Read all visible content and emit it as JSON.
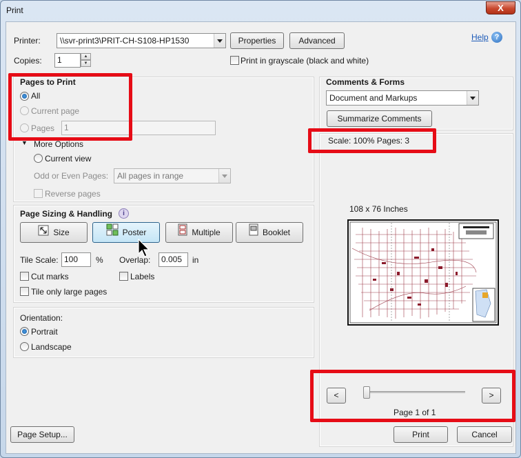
{
  "window": {
    "title": "Print",
    "close_glyph": "X"
  },
  "printer": {
    "label": "Printer:",
    "selected": "\\\\svr-print3\\PRIT-CH-S108-HP1530",
    "properties_button": "Properties",
    "advanced_button": "Advanced",
    "help_link": "Help",
    "help_icon": "?"
  },
  "copies": {
    "label": "Copies:",
    "value": "1",
    "grayscale_label": "Print in grayscale (black and white)"
  },
  "pages_to_print": {
    "title": "Pages to Print",
    "all_label": "All",
    "current_page_label": "Current page",
    "pages_label": "Pages",
    "pages_value": "1",
    "more_options_label": "More Options",
    "current_view_label": "Current view",
    "odd_even_label": "Odd or Even Pages:",
    "odd_even_value": "All pages in range",
    "reverse_label": "Reverse pages"
  },
  "page_sizing": {
    "title": "Page Sizing & Handling",
    "info_glyph": "i",
    "size_button": "Size",
    "poster_button": "Poster",
    "multiple_button": "Multiple",
    "booklet_button": "Booklet",
    "tile_scale_label": "Tile Scale:",
    "tile_scale_value": "100",
    "tile_scale_unit": "%",
    "overlap_label": "Overlap:",
    "overlap_value": "0.005",
    "overlap_unit": "in",
    "cut_marks_label": "Cut marks",
    "labels_label": "Labels",
    "tile_large_label": "Tile only large pages"
  },
  "orientation": {
    "title": "Orientation:",
    "portrait_label": "Portrait",
    "landscape_label": "Landscape"
  },
  "comments_forms": {
    "title": "Comments & Forms",
    "selected": "Document and Markups",
    "summarize_button": "Summarize Comments"
  },
  "preview": {
    "scale_text": "Scale: 100% Pages: 3",
    "size_text": "108 x 76 Inches",
    "prev_button": "<",
    "next_button": ">",
    "page_text": "Page 1 of 1",
    "page_slider_fraction": 0
  },
  "footer": {
    "page_setup_button": "Page Setup...",
    "print_button": "Print",
    "cancel_button": "Cancel"
  },
  "colors": {
    "highlight": "#e60c16",
    "map_streets": "#8b1a2b"
  }
}
